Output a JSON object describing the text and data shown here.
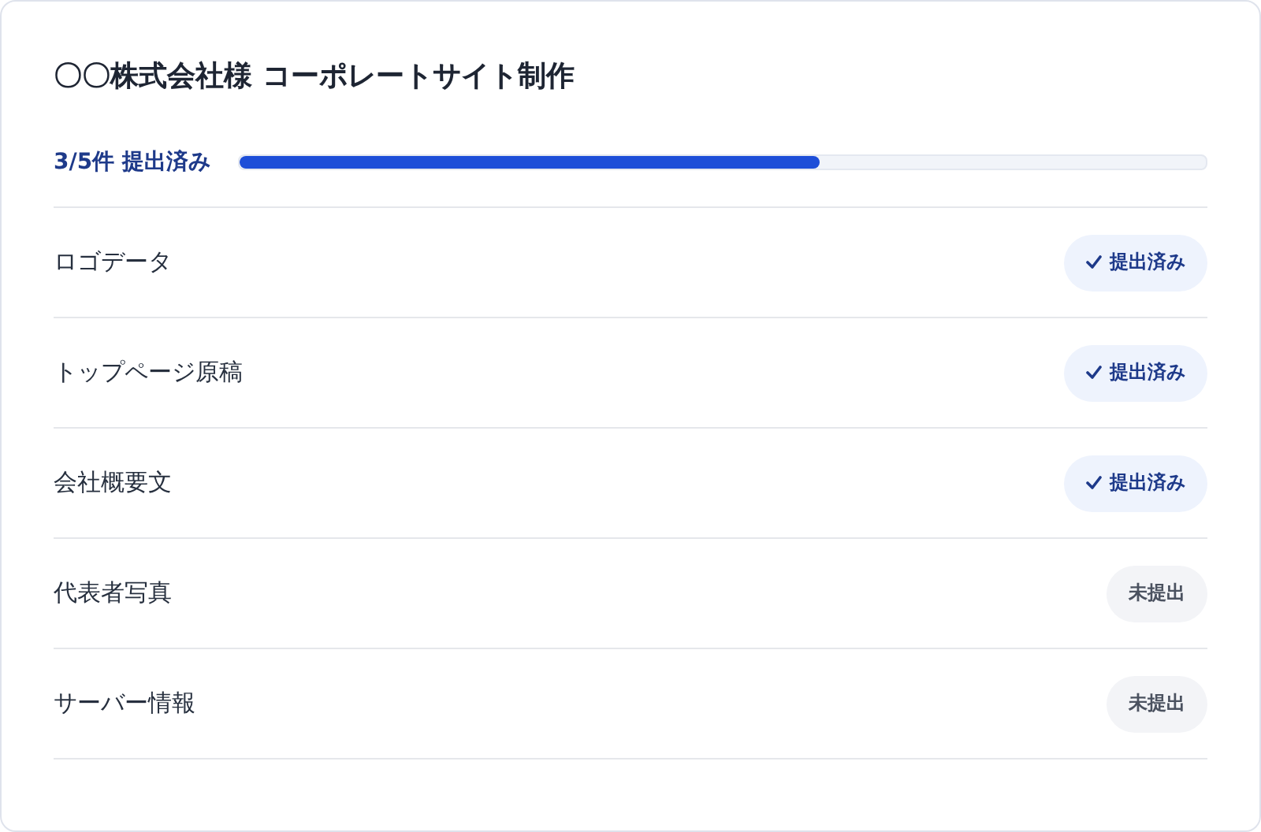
{
  "title": "〇〇株式会社様 コーポレートサイト制作",
  "progress": {
    "label": "3/5件 提出済み",
    "level": 0.6
  },
  "items": [
    {
      "name": "ロゴデータ",
      "submitted": true,
      "status": "提出済み"
    },
    {
      "name": "トップページ原稿",
      "submitted": true,
      "status": "提出済み"
    },
    {
      "name": "会社概要文",
      "submitted": true,
      "status": "提出済み"
    },
    {
      "name": "代表者写真",
      "submitted": false,
      "status": "未提出"
    },
    {
      "name": "サーバー情報",
      "submitted": false,
      "status": "未提出"
    }
  ]
}
